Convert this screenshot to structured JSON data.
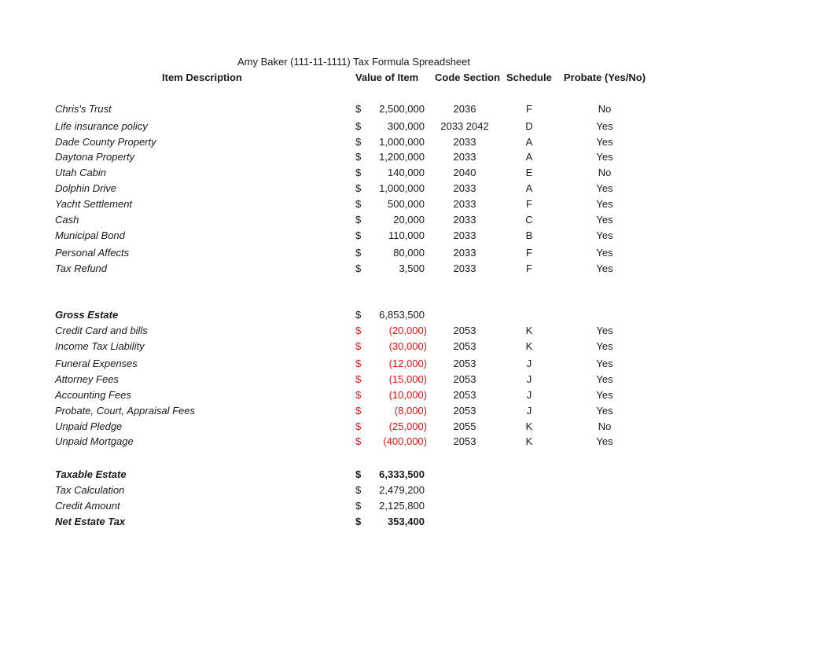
{
  "title": "Amy Baker (111-11-1111) Tax Formula Spreadsheet",
  "headers": {
    "item_description": "Item Description",
    "value_of_item": "Value of Item",
    "code_section": "Code Section",
    "schedule": "Schedule",
    "probate": "Probate (Yes/No)"
  },
  "currency_symbol": "$",
  "assets": [
    {
      "description": "Chris's Trust",
      "value": "2,500,000",
      "code": "2036",
      "schedule": "F",
      "probate": "No"
    },
    {
      "description": "Life insurance policy",
      "value": "300,000",
      "code": "2033 2042",
      "schedule": "D",
      "probate": "Yes"
    },
    {
      "description": "Dade County Property",
      "value": "1,000,000",
      "code": "2033",
      "schedule": "A",
      "probate": "Yes"
    },
    {
      "description": "Daytona Property",
      "value": "1,200,000",
      "code": "2033",
      "schedule": "A",
      "probate": "Yes"
    },
    {
      "description": "Utah Cabin",
      "value": "140,000",
      "code": "2040",
      "schedule": "E",
      "probate": "No"
    },
    {
      "description": "Dolphin Drive",
      "value": "1,000,000",
      "code": "2033",
      "schedule": "A",
      "probate": "Yes"
    },
    {
      "description": "Yacht Settlement",
      "value": "500,000",
      "code": "2033",
      "schedule": "F",
      "probate": "Yes"
    },
    {
      "description": "Cash",
      "value": "20,000",
      "code": "2033",
      "schedule": "C",
      "probate": "Yes"
    },
    {
      "description": "Municipal Bond",
      "value": "110,000",
      "code": "2033",
      "schedule": "B",
      "probate": "Yes"
    },
    {
      "description": "Personal Affects",
      "value": "80,000",
      "code": "2033",
      "schedule": "F",
      "probate": "Yes"
    },
    {
      "description": "Tax Refund",
      "value": "3,500",
      "code": "2033",
      "schedule": "F",
      "probate": "Yes"
    }
  ],
  "gross_estate": {
    "label": "Gross Estate",
    "value": "6,853,500"
  },
  "deductions": [
    {
      "description": "Credit Card and bills",
      "value": "(20,000)",
      "code": "2053",
      "schedule": "K",
      "probate": "Yes"
    },
    {
      "description": "Income Tax Liability",
      "value": "(30,000)",
      "code": "2053",
      "schedule": "K",
      "probate": "Yes"
    },
    {
      "description": "Funeral Expenses",
      "value": "(12,000)",
      "code": "2053",
      "schedule": "J",
      "probate": "Yes"
    },
    {
      "description": "Attorney Fees",
      "value": "(15,000)",
      "code": "2053",
      "schedule": "J",
      "probate": "Yes"
    },
    {
      "description": "Accounting Fees",
      "value": "(10,000)",
      "code": "2053",
      "schedule": "J",
      "probate": "Yes"
    },
    {
      "description": "Probate, Court, Appraisal Fees",
      "value": "(8,000)",
      "code": "2053",
      "schedule": "J",
      "probate": "Yes"
    },
    {
      "description": "Unpaid Pledge",
      "value": "(25,000)",
      "code": "2055",
      "schedule": "K",
      "probate": "No"
    },
    {
      "description": "Unpaid Mortgage",
      "value": "(400,000)",
      "code": "2053",
      "schedule": "K",
      "probate": "Yes"
    }
  ],
  "summary": [
    {
      "label": "Taxable Estate",
      "value": "6,333,500",
      "bold": true
    },
    {
      "label": "Tax Calculation",
      "value": "2,479,200",
      "bold": false
    },
    {
      "label": "Credit Amount",
      "value": "2,125,800",
      "bold": false
    },
    {
      "label": "Net Estate Tax",
      "value": "353,400",
      "bold": true
    }
  ],
  "colors": {
    "negative": "#ee1111",
    "text": "#1a1a1a"
  }
}
